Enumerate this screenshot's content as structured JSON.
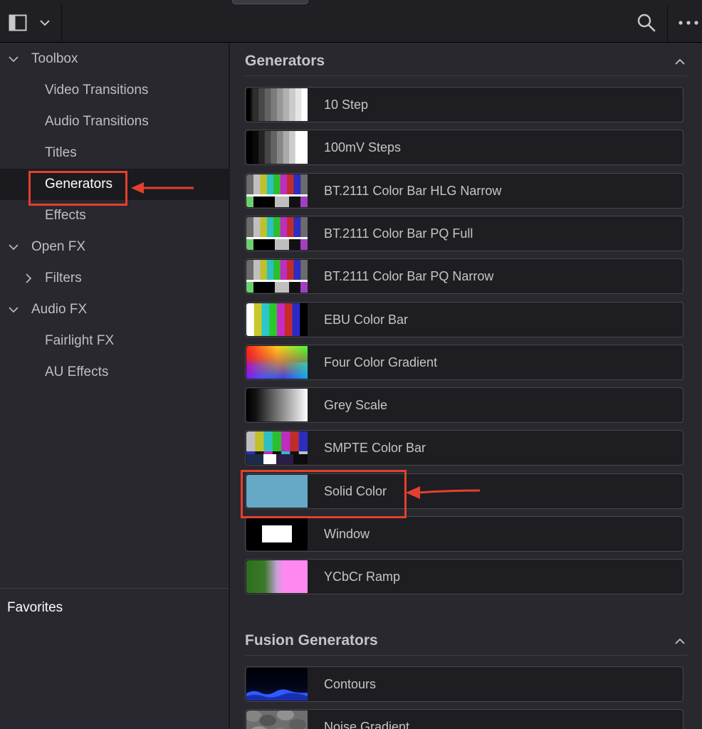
{
  "sidebar": {
    "items": [
      {
        "label": "Toolbox",
        "level": 0,
        "chevron": "down",
        "selected": false
      },
      {
        "label": "Video Transitions",
        "level": 1,
        "chevron": "none",
        "selected": false
      },
      {
        "label": "Audio Transitions",
        "level": 1,
        "chevron": "none",
        "selected": false
      },
      {
        "label": "Titles",
        "level": 1,
        "chevron": "none",
        "selected": false
      },
      {
        "label": "Generators",
        "level": 1,
        "chevron": "none",
        "selected": true
      },
      {
        "label": "Effects",
        "level": 1,
        "chevron": "none",
        "selected": false
      },
      {
        "label": "Open FX",
        "level": 0,
        "chevron": "down",
        "selected": false
      },
      {
        "label": "Filters",
        "level": 1,
        "chevron": "right",
        "selected": false
      },
      {
        "label": "Audio FX",
        "level": 0,
        "chevron": "down",
        "selected": false
      },
      {
        "label": "Fairlight FX",
        "level": 1,
        "chevron": "none",
        "selected": false
      },
      {
        "label": "AU Effects",
        "level": 1,
        "chevron": "none",
        "selected": false
      }
    ],
    "favorites_label": "Favorites"
  },
  "main": {
    "sections": [
      {
        "title": "Generators",
        "items": [
          {
            "label": "10 Step",
            "thumb": "steps10"
          },
          {
            "label": "100mV Steps",
            "thumb": "steps100mv"
          },
          {
            "label": "BT.2111 Color Bar HLG Narrow",
            "thumb": "bt2111"
          },
          {
            "label": "BT.2111 Color Bar PQ Full",
            "thumb": "bt2111"
          },
          {
            "label": "BT.2111 Color Bar PQ Narrow",
            "thumb": "bt2111"
          },
          {
            "label": "EBU Color Bar",
            "thumb": "ebu"
          },
          {
            "label": "Four Color Gradient",
            "thumb": "fourcolor"
          },
          {
            "label": "Grey Scale",
            "thumb": "greyscale"
          },
          {
            "label": "SMPTE Color Bar",
            "thumb": "smpte"
          },
          {
            "label": "Solid Color",
            "thumb": "solid"
          },
          {
            "label": "Window",
            "thumb": "window"
          },
          {
            "label": "YCbCr Ramp",
            "thumb": "ycbcr"
          }
        ]
      },
      {
        "title": "Fusion Generators",
        "items": [
          {
            "label": "Contours",
            "thumb": "contours"
          },
          {
            "label": "Noise Gradient",
            "thumb": "noise"
          }
        ]
      }
    ]
  },
  "colors": {
    "annotation": "#e3402f",
    "solid_color_swatch": "#65a9c6",
    "selected_row": "#1b1b1f"
  },
  "icons": {
    "toolbar_left": "panel-toggle-icon",
    "toolbar_dropdown": "chevron-down-icon",
    "toolbar_search": "search-icon",
    "toolbar_more": "more-options-icon",
    "section_collapse": "chevron-up-icon"
  }
}
